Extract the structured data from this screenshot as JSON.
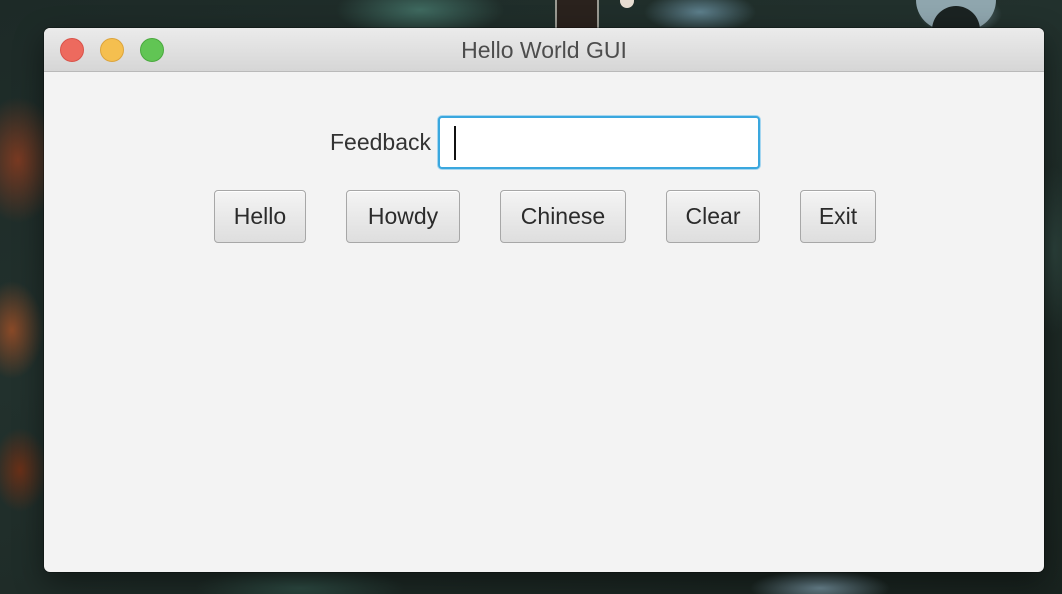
{
  "window": {
    "title": "Hello World GUI"
  },
  "form": {
    "feedback_label": "Feedback",
    "feedback_value": ""
  },
  "buttons": {
    "hello": "Hello",
    "howdy": "Howdy",
    "chinese": "Chinese",
    "clear": "Clear",
    "exit": "Exit"
  },
  "colors": {
    "close": "#ed6a5e",
    "minimize": "#f5bf4f",
    "zoom": "#61c554",
    "focus_ring": "#3aa7de"
  },
  "icons": {
    "close": "close-icon",
    "minimize": "minimize-icon",
    "zoom": "zoom-icon"
  }
}
